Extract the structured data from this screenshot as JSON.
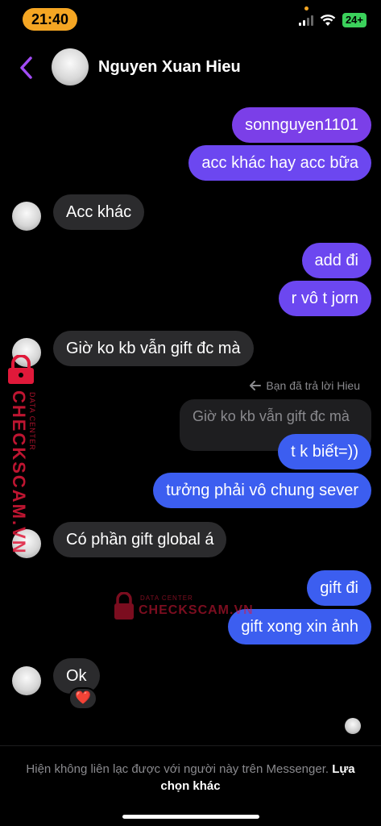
{
  "status": {
    "time": "21:40",
    "battery": "24+"
  },
  "header": {
    "name": "Nguyen Xuan Hieu"
  },
  "messages": {
    "m1": "sonnguyen1101",
    "m2": "acc khác hay acc bữa",
    "m3": "Acc khác",
    "m4": "add đi",
    "m5": "r vô t jorn",
    "m6": "Giờ ko kb vẫn gift đc mà",
    "reply_label": "Bạn đã trả lời Hieu",
    "quoted": "Giờ ko kb vẫn gift đc mà",
    "m7": "t k biết=))",
    "m8": "tưởng phải vô chung sever",
    "m9": "Có phần gift global á",
    "m10": "gift đi",
    "m11": "gift xong xin ảnh",
    "m12": "Ok",
    "reaction": "❤️"
  },
  "footer": {
    "text": "Hiện không liên lạc được với người này trên Messenger.",
    "link": "Lựa chọn khác"
  },
  "watermark": {
    "brand": "CHECKSCAM.VN",
    "sub": "DATA CENTER"
  },
  "colors": {
    "outgoing_purple": "#7b3fe8",
    "outgoing_blue": "#3c5ef0",
    "incoming": "#2b2b2d",
    "time_pill": "#f5a623",
    "watermark": "#e0193a"
  }
}
